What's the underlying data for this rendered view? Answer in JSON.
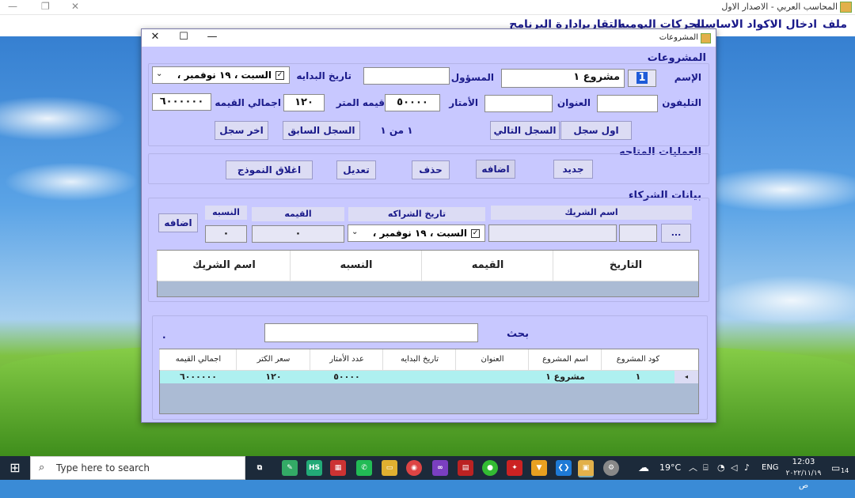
{
  "app": {
    "title": "المحاسب العربي - الاصدار الاول",
    "menu": [
      "ملف",
      "ادخال الاكواد الاساسيه",
      "الحركات اليوميه",
      "التقارير",
      "ادارة البرنامج"
    ]
  },
  "dialog": {
    "title": "المشروعات",
    "projects_section": "المشروعات",
    "fields": {
      "name_label": "الإسم",
      "code_value": "1",
      "name_value": "مشروع ١",
      "manager_label": "المسؤول",
      "manager_value": "",
      "start_date_label": "تاريخ البدايه",
      "start_date_value": "السبت ، ١٩ نوفمبر ،",
      "phone_label": "التليفون",
      "phone_value": "",
      "address_label": "العنوان",
      "address_value": "",
      "meters_label": "الأمتار",
      "meters_value": "٥٠٠٠٠",
      "meter_price_label": "قيمه المتر",
      "meter_price_value": "١٢٠",
      "total_label": "اجمالي القيمه",
      "total_value": "٦٠٠٠٠٠٠"
    },
    "nav": {
      "first": "اول سجل",
      "next": "السجل التالي",
      "position": "١ من ١",
      "previous": "السجل السابق",
      "last": "اخر سجل"
    },
    "ops_section": "العمليات المتاحه",
    "ops": {
      "new": "جديد",
      "add": "اضافه",
      "delete": "حذف",
      "edit": "تعديل",
      "close": "اغلاق النموذج"
    },
    "partners_section": "بيانات الشركاء",
    "partners": {
      "name_header": "اسم الشريك",
      "date_header": "تاريخ الشراكه",
      "value_header": "القيمه",
      "ratio_header": "النسبه",
      "browse_label": "...",
      "date_value": "السبت ، ١٩ نوفمبر ،",
      "value_value": "٠",
      "ratio_value": "٠",
      "add_button": "اضافه",
      "grid_columns": [
        "التاريخ",
        "القيمه",
        "النسبه",
        "اسم الشريك"
      ]
    },
    "search": {
      "label": "بحث",
      "value": "",
      "dot": "."
    },
    "projects_grid": {
      "columns": [
        "كود المشروع",
        "اسم المشروع",
        "العنوان",
        "تاريخ البدايه",
        "عدد الأمتار",
        "سعر الكتر",
        "اجمالي القيمه"
      ],
      "rows": [
        [
          "١",
          "مشروع ١",
          "",
          "",
          "٥٠٠٠٠",
          "١٢٠",
          "٦٠٠٠٠٠٠"
        ]
      ]
    }
  },
  "taskbar": {
    "search_placeholder": "Type here to search",
    "weather": "19°C",
    "lang": "ENG",
    "time": "12:03 ص",
    "date": "٢٠٢٢/١١/١٩",
    "notif_count": "14"
  }
}
